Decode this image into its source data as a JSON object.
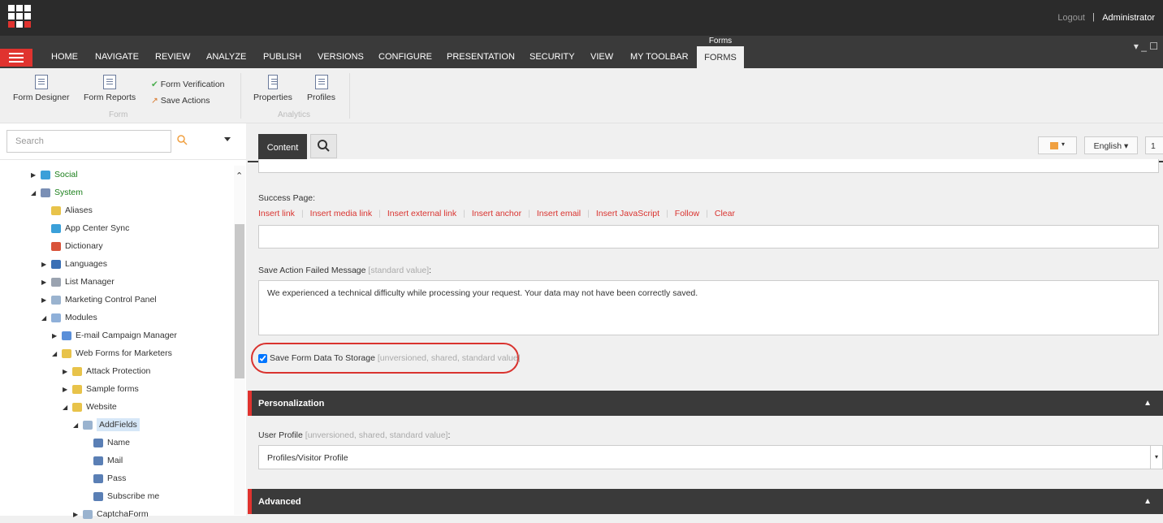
{
  "topbar": {
    "logout": "Logout",
    "separator": "|",
    "user": "Administrator"
  },
  "tabs": [
    "HOME",
    "NAVIGATE",
    "REVIEW",
    "ANALYZE",
    "PUBLISH",
    "VERSIONS",
    "CONFIGURE",
    "PRESENTATION",
    "SECURITY",
    "VIEW",
    "MY TOOLBAR"
  ],
  "context_tab": {
    "group": "Forms",
    "label": "FORMS"
  },
  "window_controls": "▾  _  ☐",
  "ribbon": {
    "form_designer": "Form Designer",
    "form_reports": "Form Reports",
    "form_verification": "Form Verification",
    "save_actions": "Save Actions",
    "group_form": "Form",
    "properties": "Properties",
    "profiles": "Profiles",
    "group_analytics": "Analytics"
  },
  "search": {
    "placeholder": "Search"
  },
  "tree": [
    {
      "label": "Social",
      "level": 1,
      "expander": "▶",
      "color": "#3aa0d9",
      "green": true
    },
    {
      "label": "System",
      "level": 1,
      "expander": "◢",
      "color": "#7a8fb5",
      "green": true
    },
    {
      "label": "Aliases",
      "level": 2,
      "expander": "",
      "color": "#e8c34a"
    },
    {
      "label": "App Center Sync",
      "level": 2,
      "expander": "",
      "color": "#3aa0d9"
    },
    {
      "label": "Dictionary",
      "level": 2,
      "expander": "",
      "color": "#d9533a"
    },
    {
      "label": "Languages",
      "level": 2,
      "expander": "▶",
      "color": "#3a6fb5"
    },
    {
      "label": "List Manager",
      "level": 2,
      "expander": "▶",
      "color": "#9aa3b0"
    },
    {
      "label": "Marketing Control Panel",
      "level": 2,
      "expander": "▶",
      "color": "#9ab3cf"
    },
    {
      "label": "Modules",
      "level": 2,
      "expander": "◢",
      "color": "#8fb0d9"
    },
    {
      "label": "E-mail Campaign Manager",
      "level": 3,
      "expander": "▶",
      "color": "#5a8fd9"
    },
    {
      "label": "Web Forms for Marketers",
      "level": 3,
      "expander": "◢",
      "color": "#e8c34a"
    },
    {
      "label": "Attack Protection",
      "level": 4,
      "expander": "▶",
      "color": "#e8c34a"
    },
    {
      "label": "Sample forms",
      "level": 4,
      "expander": "▶",
      "color": "#e8c34a"
    },
    {
      "label": "Website",
      "level": 4,
      "expander": "◢",
      "color": "#e8c34a"
    },
    {
      "label": "AddFields",
      "level": 5,
      "expander": "◢",
      "color": "#9ab3cf",
      "selected": true
    },
    {
      "label": "Name",
      "level": 6,
      "expander": "",
      "color": "#5a7fb5"
    },
    {
      "label": "Mail",
      "level": 6,
      "expander": "",
      "color": "#5a7fb5"
    },
    {
      "label": "Pass",
      "level": 6,
      "expander": "",
      "color": "#5a7fb5"
    },
    {
      "label": "Subscribe me",
      "level": 6,
      "expander": "",
      "color": "#5a7fb5"
    },
    {
      "label": "CaptchaForm",
      "level": 5,
      "expander": "▶",
      "color": "#9ab3cf"
    }
  ],
  "editor": {
    "content_tab": "Content",
    "language": "English ▾",
    "version": "1",
    "success_page_label": "Success Page:",
    "links": [
      "Insert link",
      "Insert media link",
      "Insert external link",
      "Insert anchor",
      "Insert email",
      "Insert JavaScript",
      "Follow",
      "Clear"
    ],
    "failed_label": "Save Action Failed Message",
    "failed_hint": "[standard value]",
    "failed_colon": ":",
    "failed_message": "We experienced a technical difficulty while processing your request. Your data may not have been correctly saved.",
    "save_storage_label": "Save Form Data To Storage",
    "save_storage_hint": "[unversioned, shared, standard value]",
    "save_storage_checked": true,
    "personalization_title": "Personalization",
    "user_profile_label": "User Profile",
    "user_profile_hint": "[unversioned, shared, standard value]",
    "user_profile_colon": ":",
    "user_profile_value": "Profiles/Visitor Profile",
    "advanced_title": "Advanced"
  },
  "colors": {
    "accent": "#e0332f",
    "dark": "#2b2b2b",
    "link": "#d9332f"
  }
}
